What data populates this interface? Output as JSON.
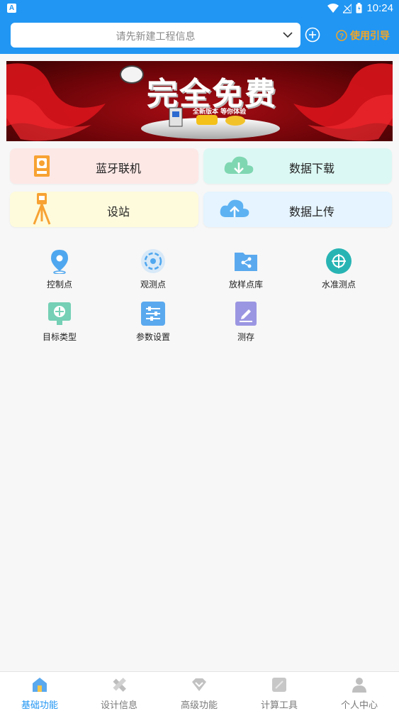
{
  "status_bar": {
    "time": "10:24"
  },
  "header": {
    "project_placeholder": "请先新建工程信息",
    "guide_label": "使用引导"
  },
  "banner": {
    "title": "完全免费",
    "subtitle": "全新版本 等你体验"
  },
  "cards": {
    "bluetooth": "蓝牙联机",
    "download": "数据下载",
    "station": "设站",
    "upload": "数据上传"
  },
  "tools": [
    {
      "label": "控制点",
      "icon": "location-pin-icon"
    },
    {
      "label": "观测点",
      "icon": "target-icon"
    },
    {
      "label": "放样点库",
      "icon": "share-folder-icon"
    },
    {
      "label": "水准测点",
      "icon": "crosshair-icon"
    },
    {
      "label": "目标类型",
      "icon": "prism-target-icon"
    },
    {
      "label": "参数设置",
      "icon": "sliders-icon"
    },
    {
      "label": "测存",
      "icon": "edit-save-icon"
    }
  ],
  "tabs": [
    {
      "label": "基础功能",
      "icon": "home-icon",
      "active": true
    },
    {
      "label": "设计信息",
      "icon": "design-tools-icon",
      "active": false
    },
    {
      "label": "高级功能",
      "icon": "diamond-icon",
      "active": false
    },
    {
      "label": "计算工具",
      "icon": "calculator-icon",
      "active": false
    },
    {
      "label": "个人中心",
      "icon": "user-icon",
      "active": false
    }
  ],
  "colors": {
    "primary": "#2196f3",
    "accent": "#f5a623",
    "active_tab": "#2196f3",
    "inactive_tab": "#7a7a7a"
  }
}
